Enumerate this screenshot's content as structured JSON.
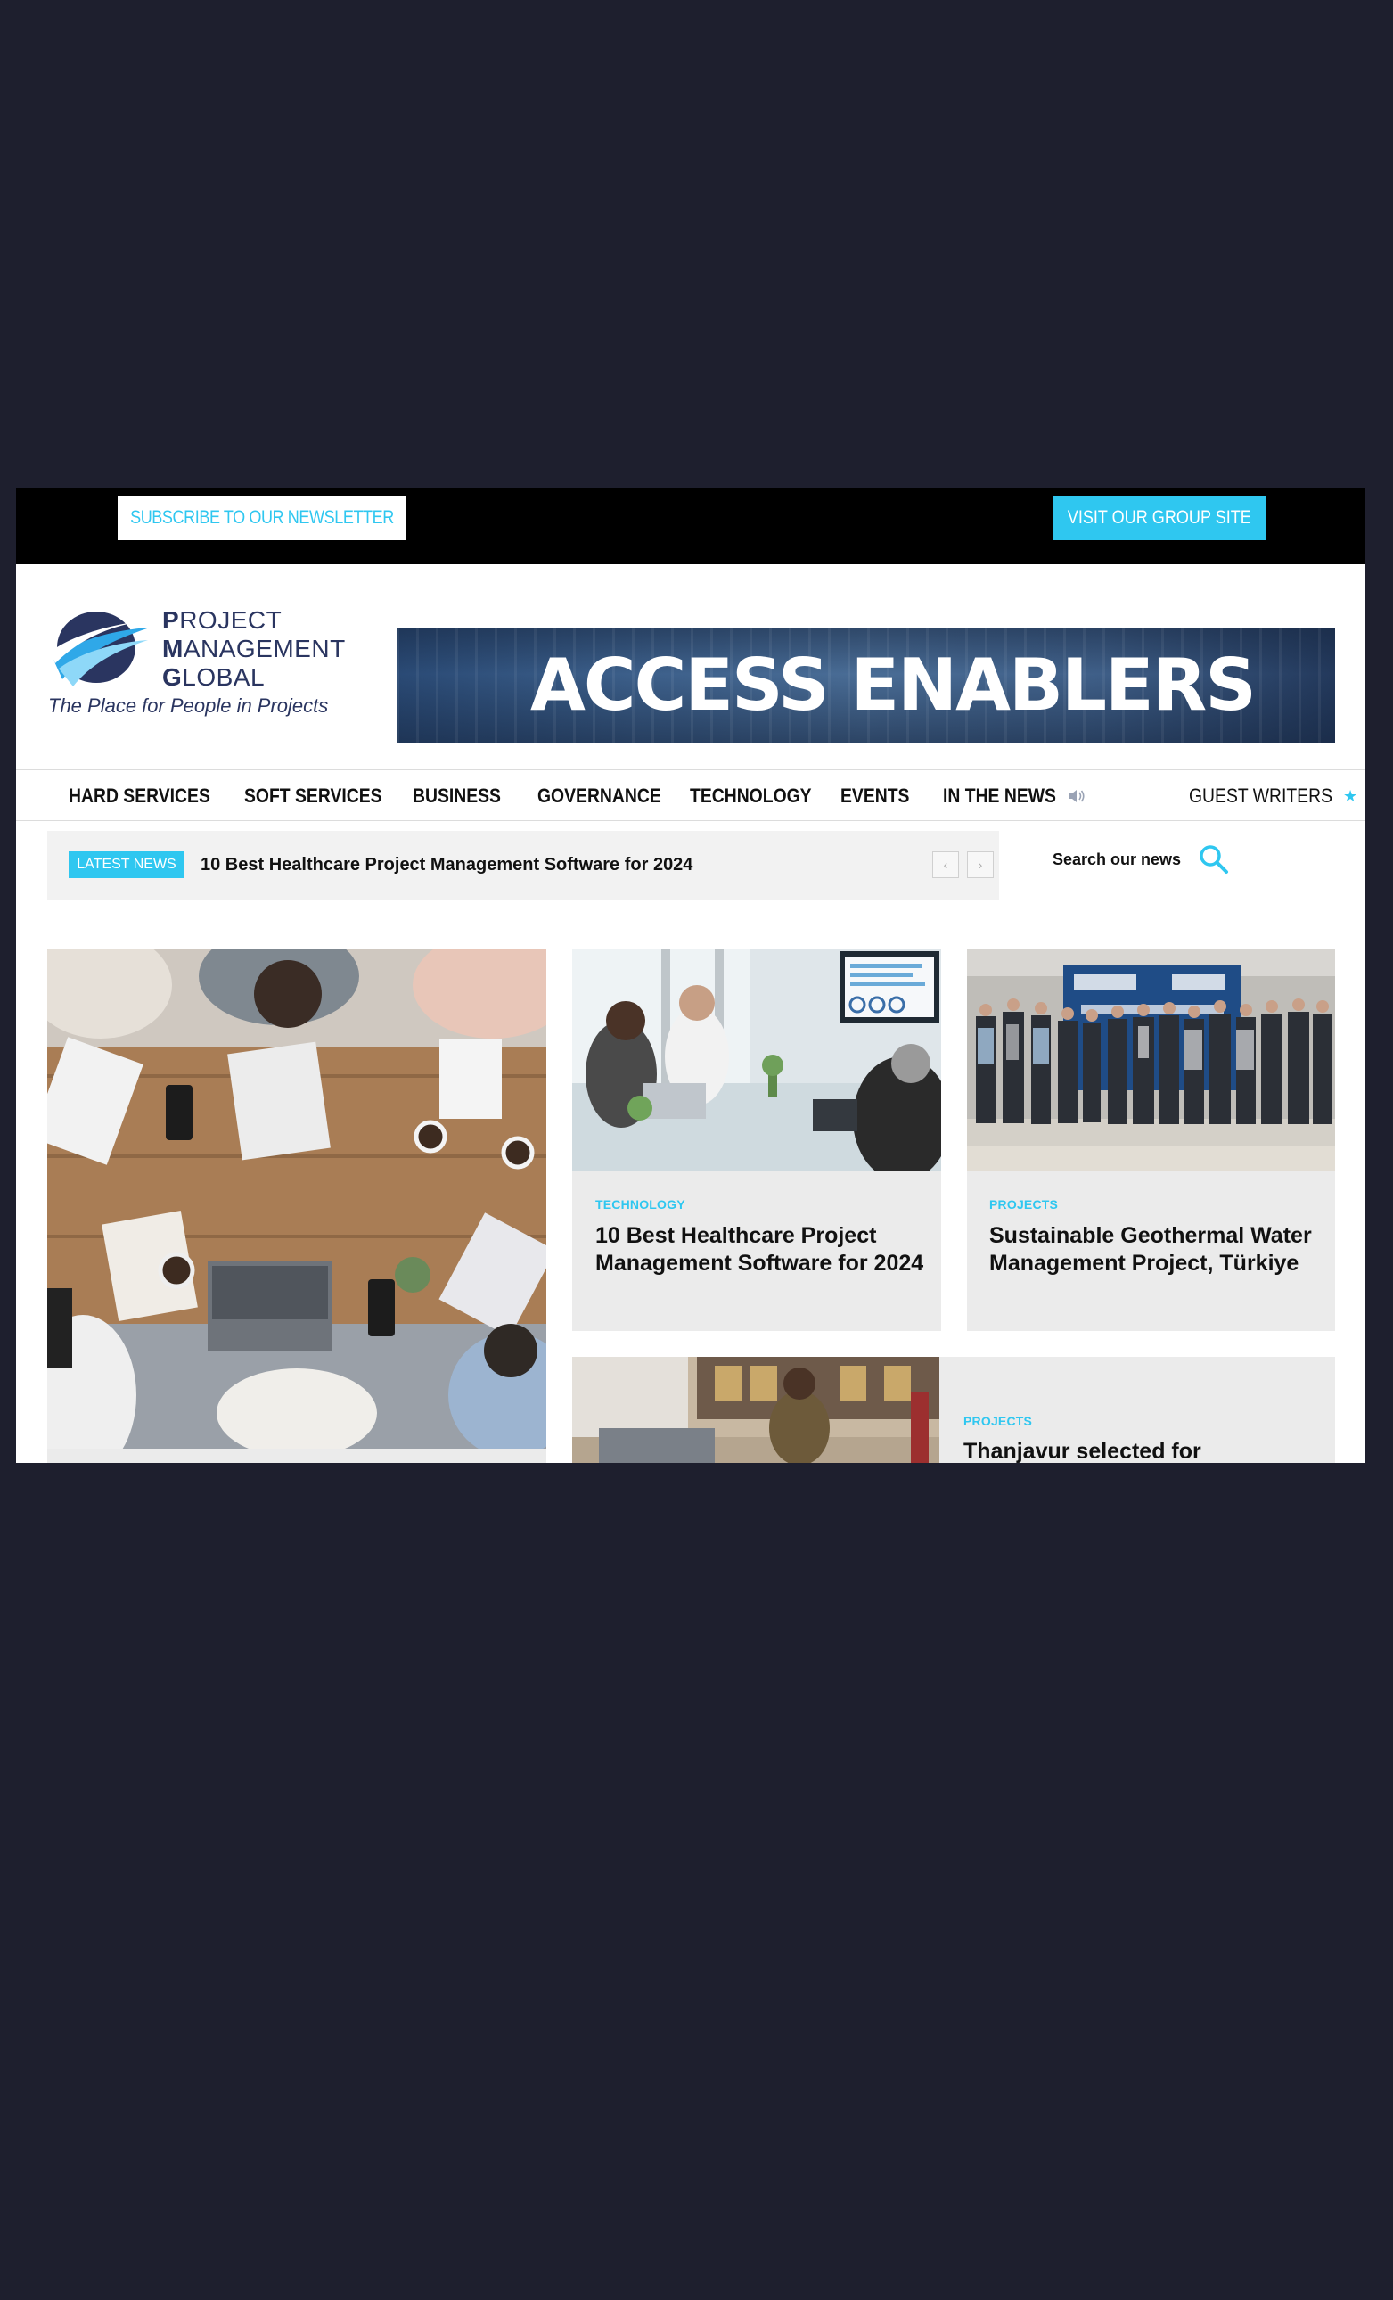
{
  "topbar": {
    "subscribe_label": "SUBSCRIBE TO OUR NEWSLETTER",
    "group_site_label": "VISIT OUR GROUP SITE"
  },
  "logo": {
    "line1_initial": "P",
    "line1_rest": "ROJECT",
    "line2_initial": "M",
    "line2_rest": "ANAGEMENT",
    "line3_initial": "G",
    "line3_rest": "LOBAL",
    "tagline": "The Place for People in Projects"
  },
  "banner": {
    "text": "ACCESS ENABLERS"
  },
  "nav": {
    "items": [
      {
        "label": "HARD SERVICES"
      },
      {
        "label": "SOFT SERVICES"
      },
      {
        "label": "BUSINESS"
      },
      {
        "label": "GOVERNANCE"
      },
      {
        "label": "TECHNOLOGY"
      },
      {
        "label": "EVENTS"
      },
      {
        "label": "IN THE NEWS"
      },
      {
        "label": "GUEST WRITERS"
      }
    ]
  },
  "ticker": {
    "badge": "LATEST NEWS",
    "headline": "10 Best Healthcare Project Management Software for 2024",
    "prev": "‹",
    "next": "›"
  },
  "search": {
    "label": "Search our news"
  },
  "cards": [
    {
      "category": "TECHNOLOGY",
      "title": "10 Best Healthcare Project Management Software for 2024"
    },
    {
      "category": "PROJECTS",
      "title": "Sustainable Geothermal Water Management Project, Türkiye"
    },
    {
      "category": "PROJECTS",
      "title": "Thanjavur selected for"
    }
  ],
  "colors": {
    "accent": "#2fc7f0",
    "page_bg": "#1e1f2e",
    "topbar_bg": "#000000",
    "brand_navy": "#2a3560"
  }
}
